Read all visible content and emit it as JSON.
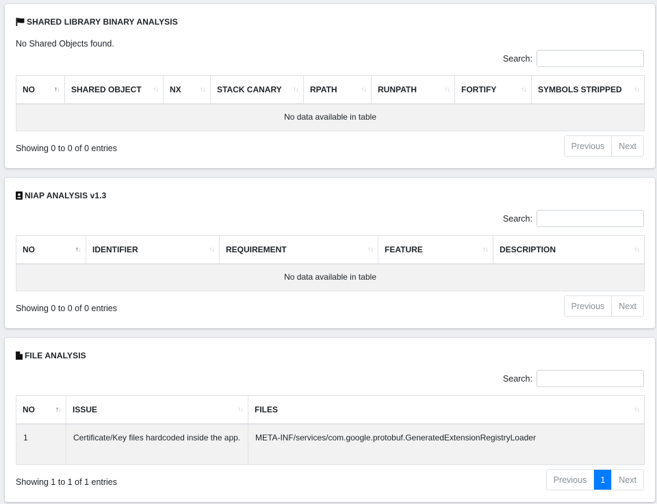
{
  "shared_lib": {
    "title": "SHARED LIBRARY BINARY ANALYSIS",
    "icon": "flag-icon",
    "message": "No Shared Objects found.",
    "search_label": "Search:",
    "columns": [
      "NO",
      "SHARED OBJECT",
      "NX",
      "STACK CANARY",
      "RPATH",
      "RUNPATH",
      "FORTIFY",
      "SYMBOLS STRIPPED"
    ],
    "empty_text": "No data available in table",
    "info": "Showing 0 to 0 of 0 entries",
    "prev_label": "Previous",
    "next_label": "Next"
  },
  "niap": {
    "title": "NIAP ANALYSIS v1.3",
    "icon": "id-card-icon",
    "search_label": "Search:",
    "columns": [
      "NO",
      "IDENTIFIER",
      "REQUIREMENT",
      "FEATURE",
      "DESCRIPTION"
    ],
    "empty_text": "No data available in table",
    "info": "Showing 0 to 0 of 0 entries",
    "prev_label": "Previous",
    "next_label": "Next"
  },
  "file_analysis": {
    "title": "FILE ANALYSIS",
    "icon": "file-icon",
    "search_label": "Search:",
    "columns": [
      "NO",
      "ISSUE",
      "FILES"
    ],
    "rows": [
      {
        "no": "1",
        "issue": "Certificate/Key files hardcoded inside the app.",
        "files": "META-INF/services/com.google.protobuf.GeneratedExtensionRegistryLoader"
      }
    ],
    "info": "Showing 1 to 1 of 1 entries",
    "prev_label": "Previous",
    "page": "1",
    "next_label": "Next"
  },
  "colors": {
    "accent": "#007bff",
    "background": "#eceef1",
    "row_bg": "#f2f2f2"
  }
}
